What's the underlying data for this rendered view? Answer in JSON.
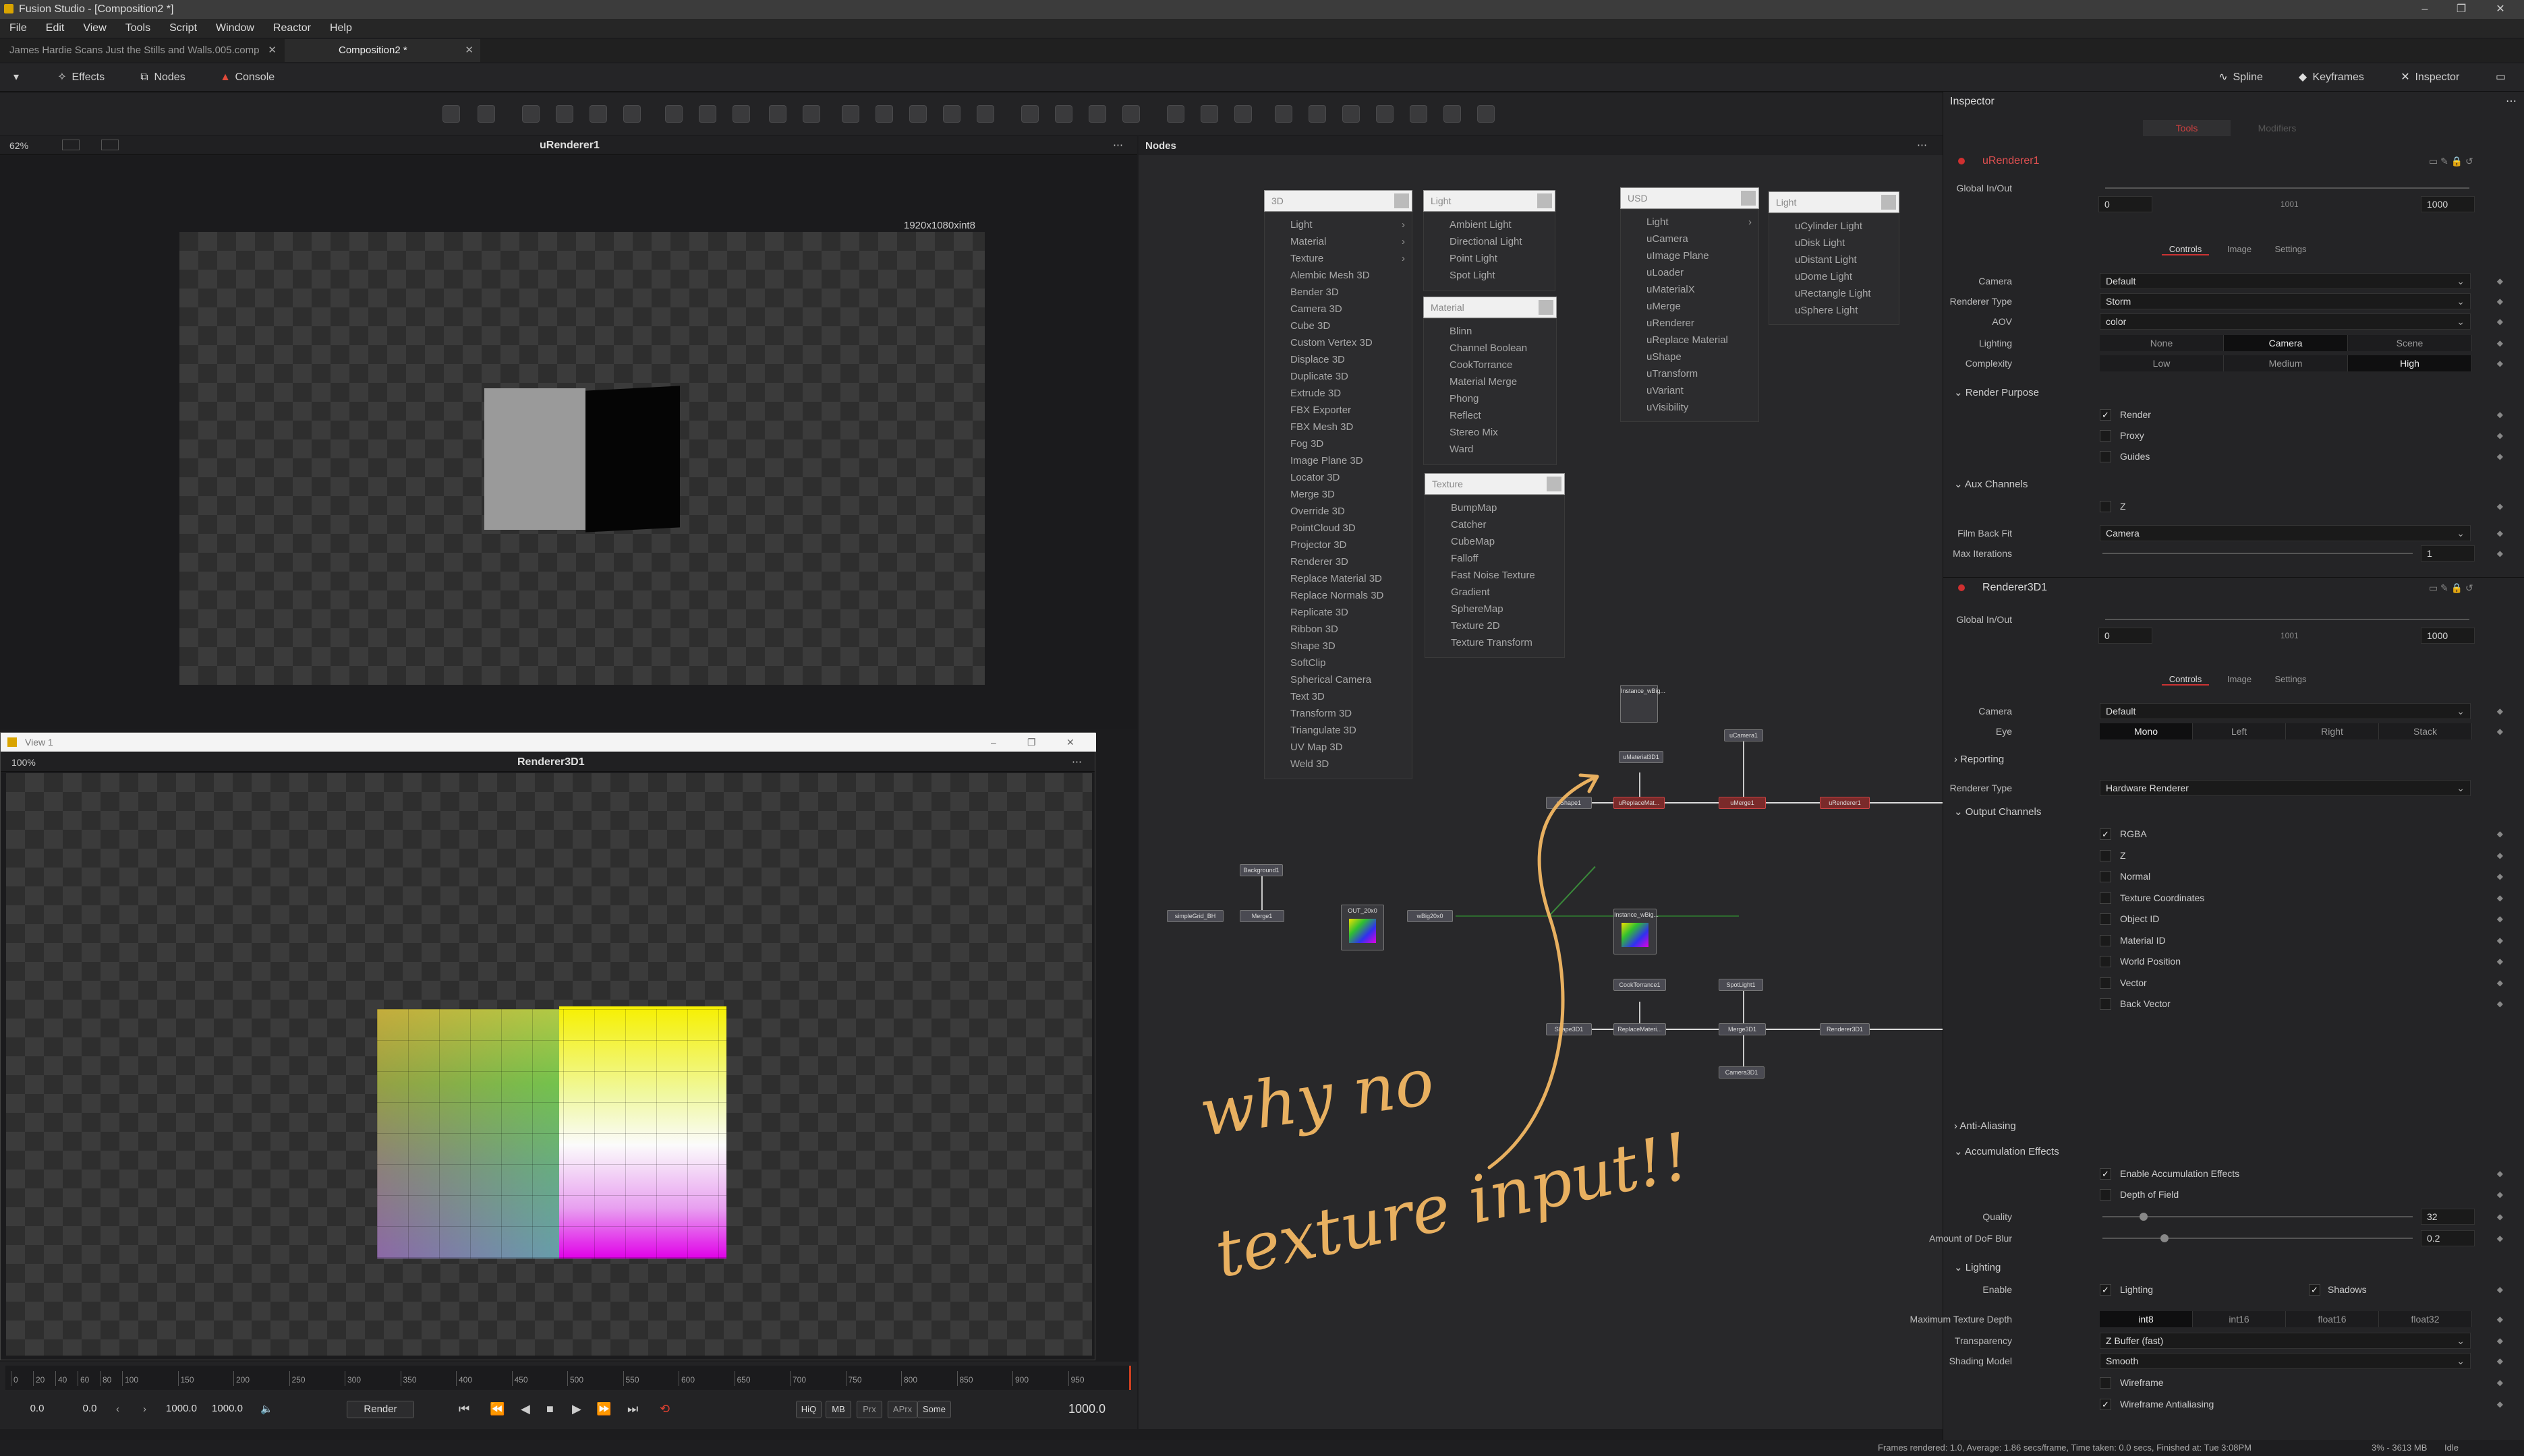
{
  "app": {
    "title": "Fusion Studio - [Composition2 *]"
  },
  "window_controls": [
    "–",
    "❐",
    "✕"
  ],
  "menu": [
    "File",
    "Edit",
    "View",
    "Tools",
    "Script",
    "Window",
    "Reactor",
    "Help"
  ],
  "doc_tabs": [
    {
      "label": "James Hardie Scans Just the Stills and Walls.005.comp"
    },
    {
      "label": "Composition2 *"
    }
  ],
  "toolbar": {
    "effects": "Effects",
    "nodes": "Nodes",
    "console": "Console",
    "spline": "Spline",
    "keyframes": "Keyframes",
    "inspector": "Inspector"
  },
  "viewer1": {
    "zoom": "62%",
    "title": "uRenderer1",
    "resolution": "1920x1080xint8"
  },
  "viewer2": {
    "window_title": "View 1",
    "zoom": "100%",
    "title": "Renderer3D1"
  },
  "nodes_panel": {
    "title": "Nodes"
  },
  "menus": {
    "m3d": {
      "header": "3D",
      "items": [
        {
          "label": "Light",
          "sub": true
        },
        {
          "label": "Material",
          "sub": true
        },
        {
          "label": "Texture",
          "sub": true
        },
        {
          "label": "Alembic Mesh 3D"
        },
        {
          "label": "Bender 3D"
        },
        {
          "label": "Camera 3D"
        },
        {
          "label": "Cube 3D"
        },
        {
          "label": "Custom Vertex 3D"
        },
        {
          "label": "Displace 3D"
        },
        {
          "label": "Duplicate 3D"
        },
        {
          "label": "Extrude 3D"
        },
        {
          "label": "FBX Exporter"
        },
        {
          "label": "FBX Mesh 3D"
        },
        {
          "label": "Fog 3D"
        },
        {
          "label": "Image Plane 3D"
        },
        {
          "label": "Locator 3D"
        },
        {
          "label": "Merge 3D"
        },
        {
          "label": "Override 3D"
        },
        {
          "label": "PointCloud 3D"
        },
        {
          "label": "Projector 3D"
        },
        {
          "label": "Renderer 3D"
        },
        {
          "label": "Replace Material 3D"
        },
        {
          "label": "Replace Normals 3D"
        },
        {
          "label": "Replicate 3D"
        },
        {
          "label": "Ribbon 3D"
        },
        {
          "label": "Shape 3D"
        },
        {
          "label": "SoftClip"
        },
        {
          "label": "Spherical Camera"
        },
        {
          "label": "Text 3D"
        },
        {
          "label": "Transform 3D"
        },
        {
          "label": "Triangulate 3D"
        },
        {
          "label": "UV Map 3D"
        },
        {
          "label": "Weld 3D"
        }
      ]
    },
    "light": {
      "header": "Light",
      "items": [
        "Ambient Light",
        "Directional Light",
        "Point Light",
        "Spot Light"
      ]
    },
    "material": {
      "header": "Material",
      "items": [
        "Blinn",
        "Channel Boolean",
        "CookTorrance",
        "Material Merge",
        "Phong",
        "Reflect",
        "Stereo Mix",
        "Ward"
      ]
    },
    "texture": {
      "header": "Texture",
      "items": [
        "BumpMap",
        "Catcher",
        "CubeMap",
        "Falloff",
        "Fast Noise Texture",
        "Gradient",
        "SphereMap",
        "Texture 2D",
        "Texture Transform"
      ]
    },
    "usd": {
      "header": "USD",
      "items": [
        {
          "label": "Light",
          "sub": true
        },
        {
          "label": "uCamera"
        },
        {
          "label": "uImage Plane"
        },
        {
          "label": "uLoader"
        },
        {
          "label": "uMaterialX"
        },
        {
          "label": "uMerge"
        },
        {
          "label": "uRenderer"
        },
        {
          "label": "uReplace Material"
        },
        {
          "label": "uShape"
        },
        {
          "label": "uTransform"
        },
        {
          "label": "uVariant"
        },
        {
          "label": "uVisibility"
        }
      ]
    },
    "ulight": {
      "header": "Light",
      "items": [
        "uCylinder Light",
        "uDisk Light",
        "uDistant Light",
        "uDome Light",
        "uRectangle Light",
        "uSphere Light"
      ]
    }
  },
  "graph": {
    "nodes": {
      "instance1": "Instance_wBig...",
      "umaterial": "uMaterial3D1",
      "ucamera": "uCamera1",
      "ushape": "uShape1",
      "ureplace": "uReplaceMat...",
      "umerge": "uMerge1",
      "urenderer": "uRenderer1",
      "background": "Background1",
      "simple": "simpleGrid_BH",
      "merge1": "Merge1",
      "lut": "OUT_20x0",
      "wbig": "wBig20x0",
      "instance2": "Instance_wBig...",
      "cooktorrance": "CookTorrance1",
      "spotlight": "SpotLight1",
      "shape3d": "Shape3D1",
      "replacemat": "ReplaceMateri...",
      "merge3d": "Merge3D1",
      "renderer3d": "Renderer3D1",
      "camera3d": "Camera3D1"
    }
  },
  "annotation": {
    "line1": "why no",
    "line2": "texture input!!"
  },
  "inspector": {
    "title": "Inspector",
    "tabs": {
      "tools": "Tools",
      "modifiers": "Modifiers"
    },
    "subtabs": [
      "Controls",
      "Image",
      "Settings"
    ],
    "urenderer": {
      "name": "uRenderer1",
      "global": "Global In/Out",
      "in": "0",
      "mid": "1001",
      "out": "1000",
      "camera_label": "Camera",
      "camera": "Default",
      "rtype_label": "Renderer Type",
      "rtype": "Storm",
      "aov_label": "AOV",
      "aov": "color",
      "lighting_label": "Lighting",
      "lighting": [
        "None",
        "Camera",
        "Scene"
      ],
      "complexity_label": "Complexity",
      "complexity": [
        "Low",
        "Medium",
        "High"
      ],
      "render_purpose": "Render Purpose",
      "purposes": [
        "Render",
        "Proxy",
        "Guides"
      ],
      "aux": "Aux Channels",
      "z": "Z",
      "filmback_label": "Film Back Fit",
      "filmback": "Camera",
      "maxit_label": "Max Iterations",
      "maxit": "1"
    },
    "renderer3d": {
      "name": "Renderer3D1",
      "global": "Global In/Out",
      "in": "0",
      "mid": "1001",
      "out": "1000",
      "camera_label": "Camera",
      "camera": "Default",
      "eye_label": "Eye",
      "eye": [
        "Mono",
        "Left",
        "Right",
        "Stack"
      ],
      "reporting": "Reporting",
      "rtype_label": "Renderer Type",
      "rtype": "Hardware Renderer",
      "output_channels": "Output Channels",
      "channels": [
        "RGBA",
        "Z",
        "Normal",
        "Texture Coordinates",
        "Object ID",
        "Material ID",
        "World Position",
        "Vector",
        "Back Vector"
      ],
      "antialias": "Anti-Aliasing",
      "accum": "Accumulation Effects",
      "enable_accum": "Enable Accumulation Effects",
      "dof": "Depth of Field",
      "quality_label": "Quality",
      "quality": "32",
      "dofblur_label": "Amount of DoF Blur",
      "dofblur": "0.2",
      "lighting": "Lighting",
      "enable_label": "Enable",
      "lighting_cb": "Lighting",
      "shadows_cb": "Shadows",
      "mtd_label": "Maximum Texture Depth",
      "mtd": [
        "int8",
        "int16",
        "float16",
        "float32"
      ],
      "transp_label": "Transparency",
      "transp": "Z Buffer (fast)",
      "shading_label": "Shading Model",
      "shading": "Smooth",
      "wireframe": "Wireframe",
      "wireframe_aa": "Wireframe Antialiasing"
    }
  },
  "timeline": {
    "ticks": [
      "0",
      "20",
      "40",
      "60",
      "80",
      "100",
      "150",
      "200",
      "250",
      "300",
      "350",
      "400",
      "450",
      "500",
      "550",
      "600",
      "650",
      "700",
      "750",
      "800",
      "850",
      "900",
      "950"
    ],
    "start": "0.0",
    "render_start": "0.0",
    "render_end": "1000.0",
    "end": "1000.0",
    "render_btn": "Render",
    "current": "1000.0",
    "flags": [
      "HiQ",
      "MB",
      "Prx",
      "APrx",
      "Some"
    ]
  },
  "status": {
    "left": "Frames rendered: 1.0,  Average: 1.86 secs/frame,  Time taken: 0.0 secs,  Finished at: Tue 3:08PM",
    "mem": "3% - 3613 MB",
    "state": "Idle"
  }
}
